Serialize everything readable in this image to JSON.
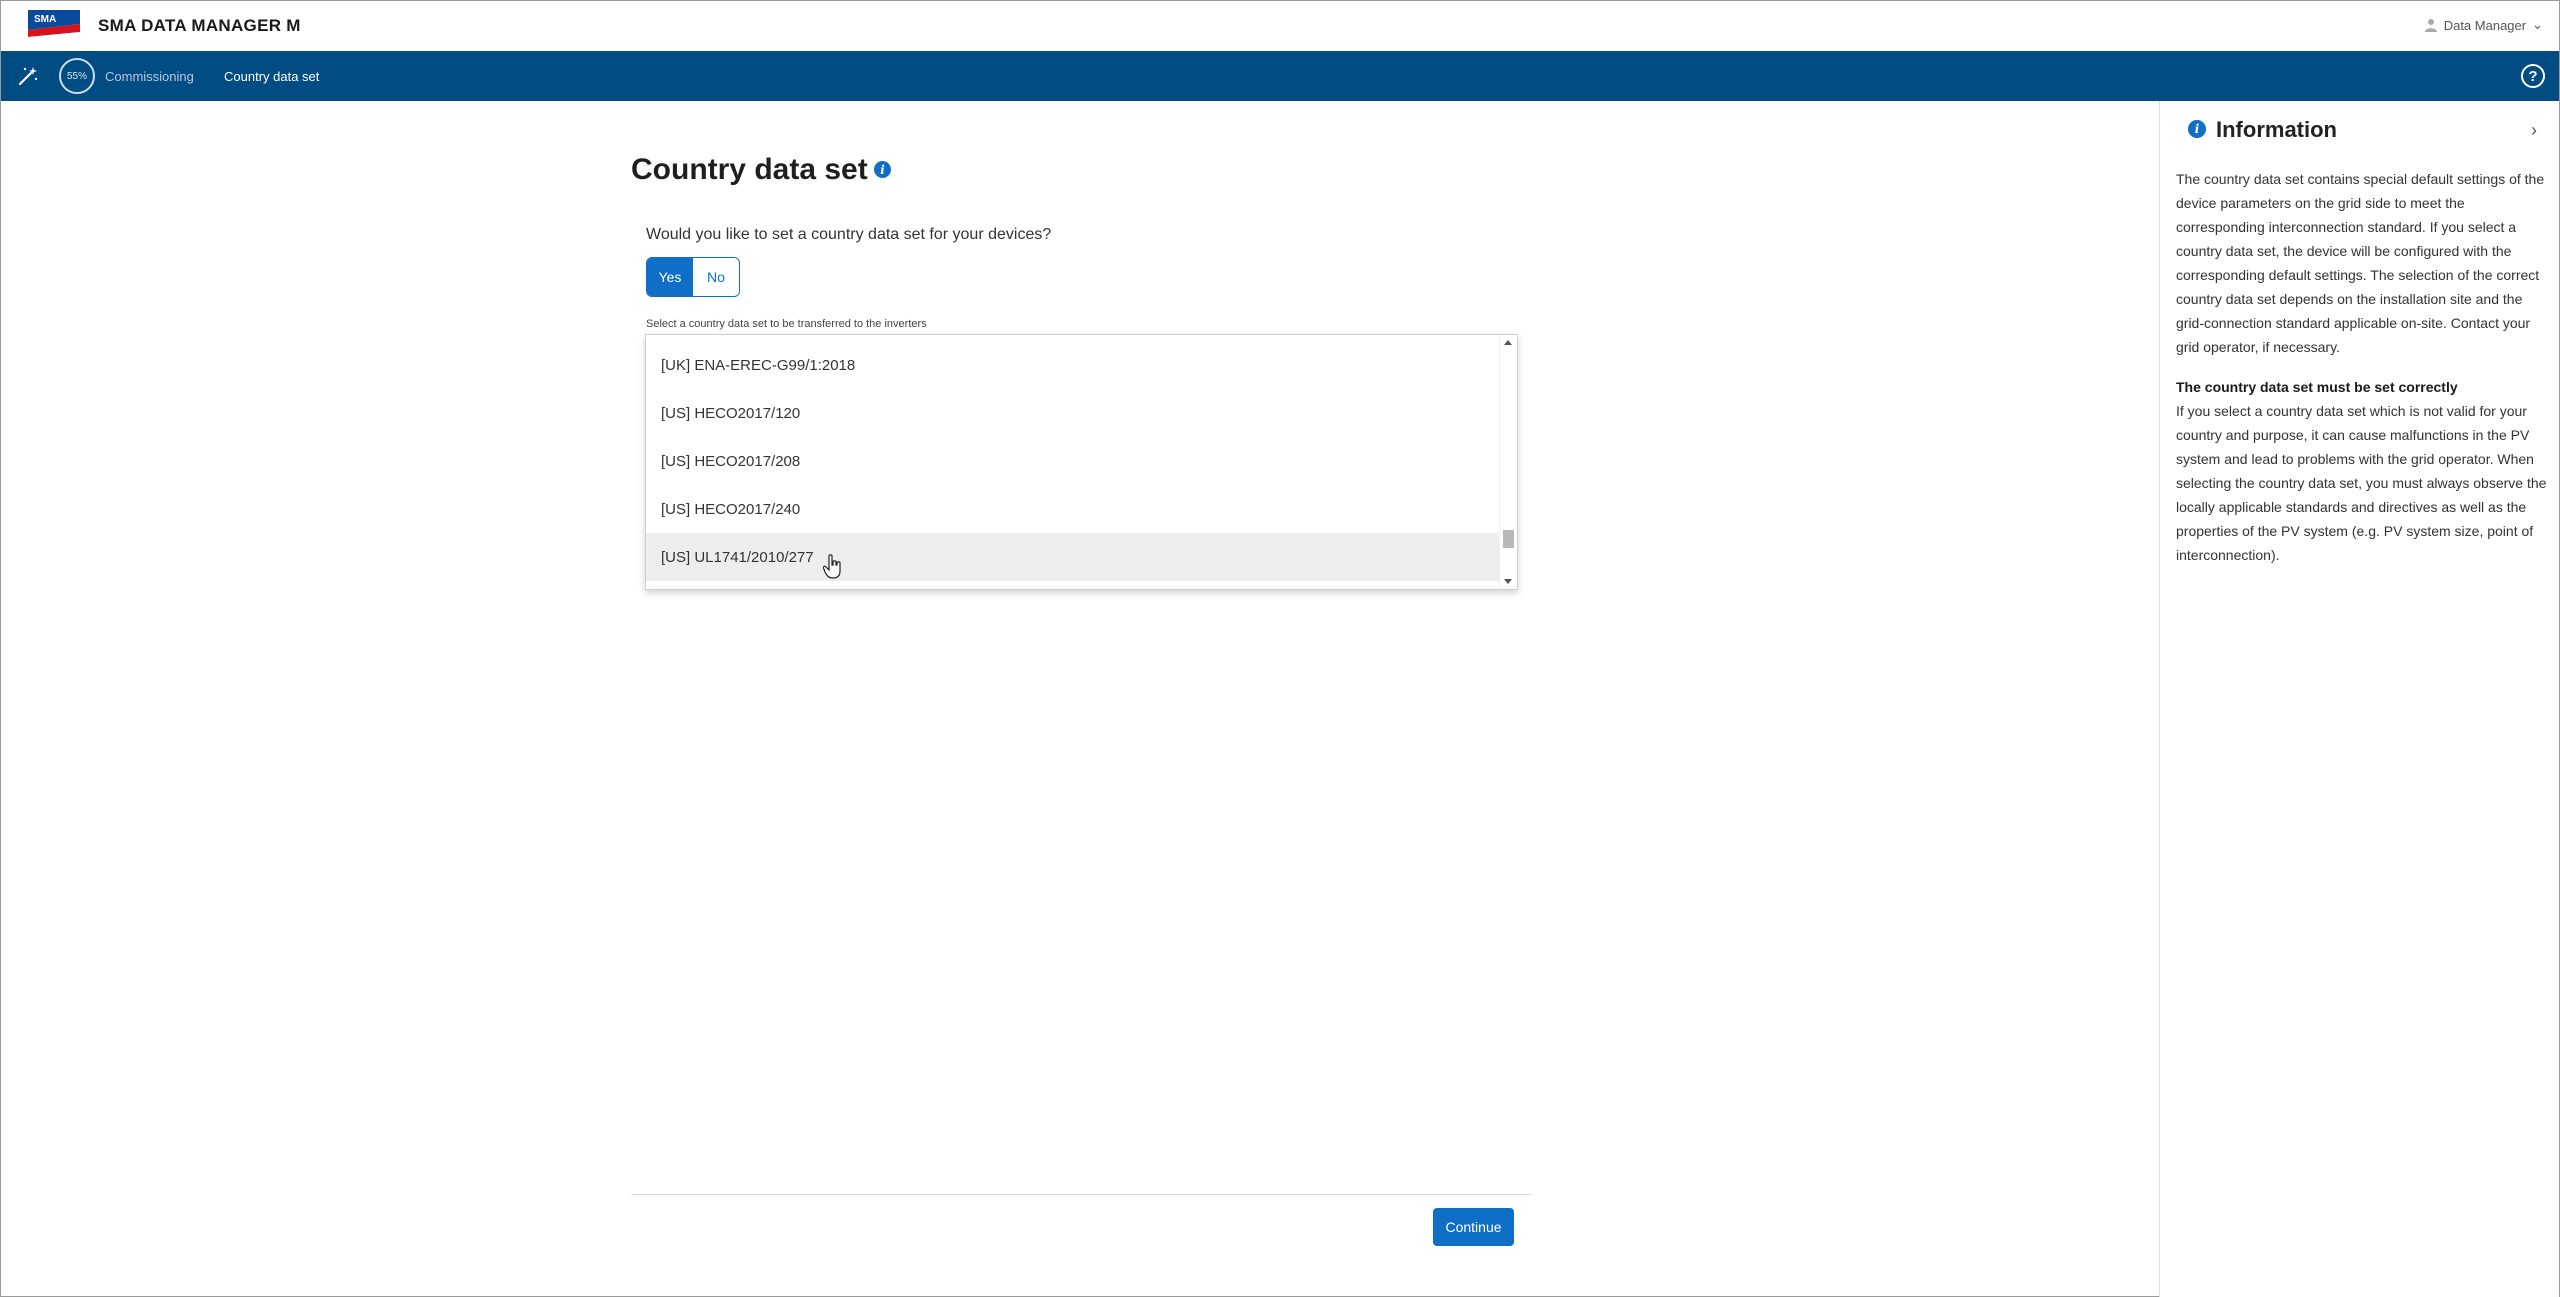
{
  "header": {
    "brand": "SMA DATA MANAGER M",
    "logo_text": "SMA",
    "user_label": "Data Manager"
  },
  "nav": {
    "progress": "55%",
    "crumb_commissioning": "Commissioning",
    "crumb_current": "Country data set",
    "help_icon": "question-circle-icon"
  },
  "main": {
    "title": "Country data set",
    "question": "Would you like to set a country data set for your devices?",
    "toggle": {
      "yes": "Yes",
      "no": "No",
      "selected": "Yes"
    },
    "select_label": "Select a country data set to be transferred to the inverters",
    "options": [
      "[UK] ENA-EREC-G99/1:2018",
      "[US] HECO2017/120",
      "[US] HECO2017/208",
      "[US] HECO2017/240",
      "[US] UL1741/2010/277"
    ],
    "hovered_option": "[US] UL1741/2010/277",
    "continue_label": "Continue"
  },
  "info_panel": {
    "title": "Information",
    "paragraph1": "The country data set contains special default settings of the device parameters on the grid side to meet the corresponding interconnection standard. If you select a country data set, the device will be configured with the corresponding default settings. The selection of the correct country data set depends on the installation site and the grid-connection standard applicable on-site. Contact your grid operator, if necessary.",
    "heading2": "The country data set must be set correctly",
    "paragraph2": "If you select a country data set which is not valid for your country and purpose, it can cause malfunctions in the PV system and lead to problems with the grid operator. When selecting the country data set, you must always observe the locally applicable standards and directives as well as the properties of the PV system (e.g. PV system size, point of interconnection)."
  },
  "colors": {
    "nav_blue": "#004c83",
    "accent_blue": "#0f6fc6",
    "logo_red": "#d7121a"
  }
}
